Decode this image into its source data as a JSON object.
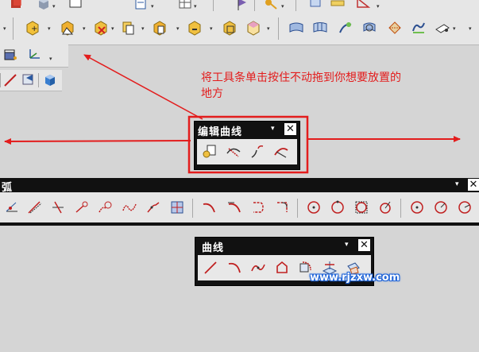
{
  "annotation": {
    "line1": "将工具条单击按住不动拖到你想要放置的",
    "line2": "地方"
  },
  "edit_curve_toolbar": {
    "title": "编辑曲线",
    "menu_glyph": "▾",
    "close_glyph": "✕"
  },
  "arc_toolbar": {
    "title": "弧",
    "menu_glyph": "▾",
    "close_glyph": "✕"
  },
  "curve_toolbar": {
    "title": "曲线",
    "menu_glyph": "▾",
    "close_glyph": "✕"
  },
  "watermark": {
    "text": "www.rjzxw.com"
  },
  "icons": {
    "row1": [
      "part-icon",
      "cube-icon",
      "new-icon",
      "document-icon",
      "flag-icon",
      "table-icon",
      "pin-icon",
      "key-icon",
      "ruler-icon",
      "measure-icon"
    ],
    "row2": [
      "insert-feature-icon",
      "move-feature-icon",
      "delete-feature-icon",
      "copy-feature-icon",
      "reorder-feature-icon",
      "replace-feature-icon",
      "pattern-feature-icon",
      "suppress-feature-icon",
      "surface-icon",
      "mesh-surface-icon",
      "sweep-icon",
      "offset-surface-icon",
      "blend-surface-icon",
      "bounded-surface-icon",
      "trim-icon"
    ],
    "row3": [
      "sketch-icon",
      "datum-csys-icon"
    ],
    "row4": [
      "line-tool-icon",
      "view-icon",
      "solid-cube-icon"
    ],
    "edit_curve": [
      "edit-parameters-icon",
      "trim-curve-icon",
      "split-curve-icon",
      "edit-arc-length-icon"
    ],
    "arc": [
      "point-icon",
      "line-icon",
      "line-perp-icon",
      "line-point-icon",
      "arc-chain-icon",
      "spline-icon",
      "fillet-curve-icon",
      "rectangle-grid-icon",
      "arc-3pt-icon",
      "arc-tangent-icon",
      "arc-dash-icon",
      "arc-corner-icon",
      "circle-icon",
      "circle-point-icon",
      "circle-square-icon",
      "circle-tangent-icon",
      "circle-center-icon",
      "circle-radius-icon",
      "circle-full-icon"
    ],
    "curve": [
      "straight-line-icon",
      "arc-curve-icon",
      "studio-spline-icon",
      "polygon-icon",
      "offset-curve-icon",
      "project-curve-icon",
      "intersect-curve-icon"
    ]
  }
}
